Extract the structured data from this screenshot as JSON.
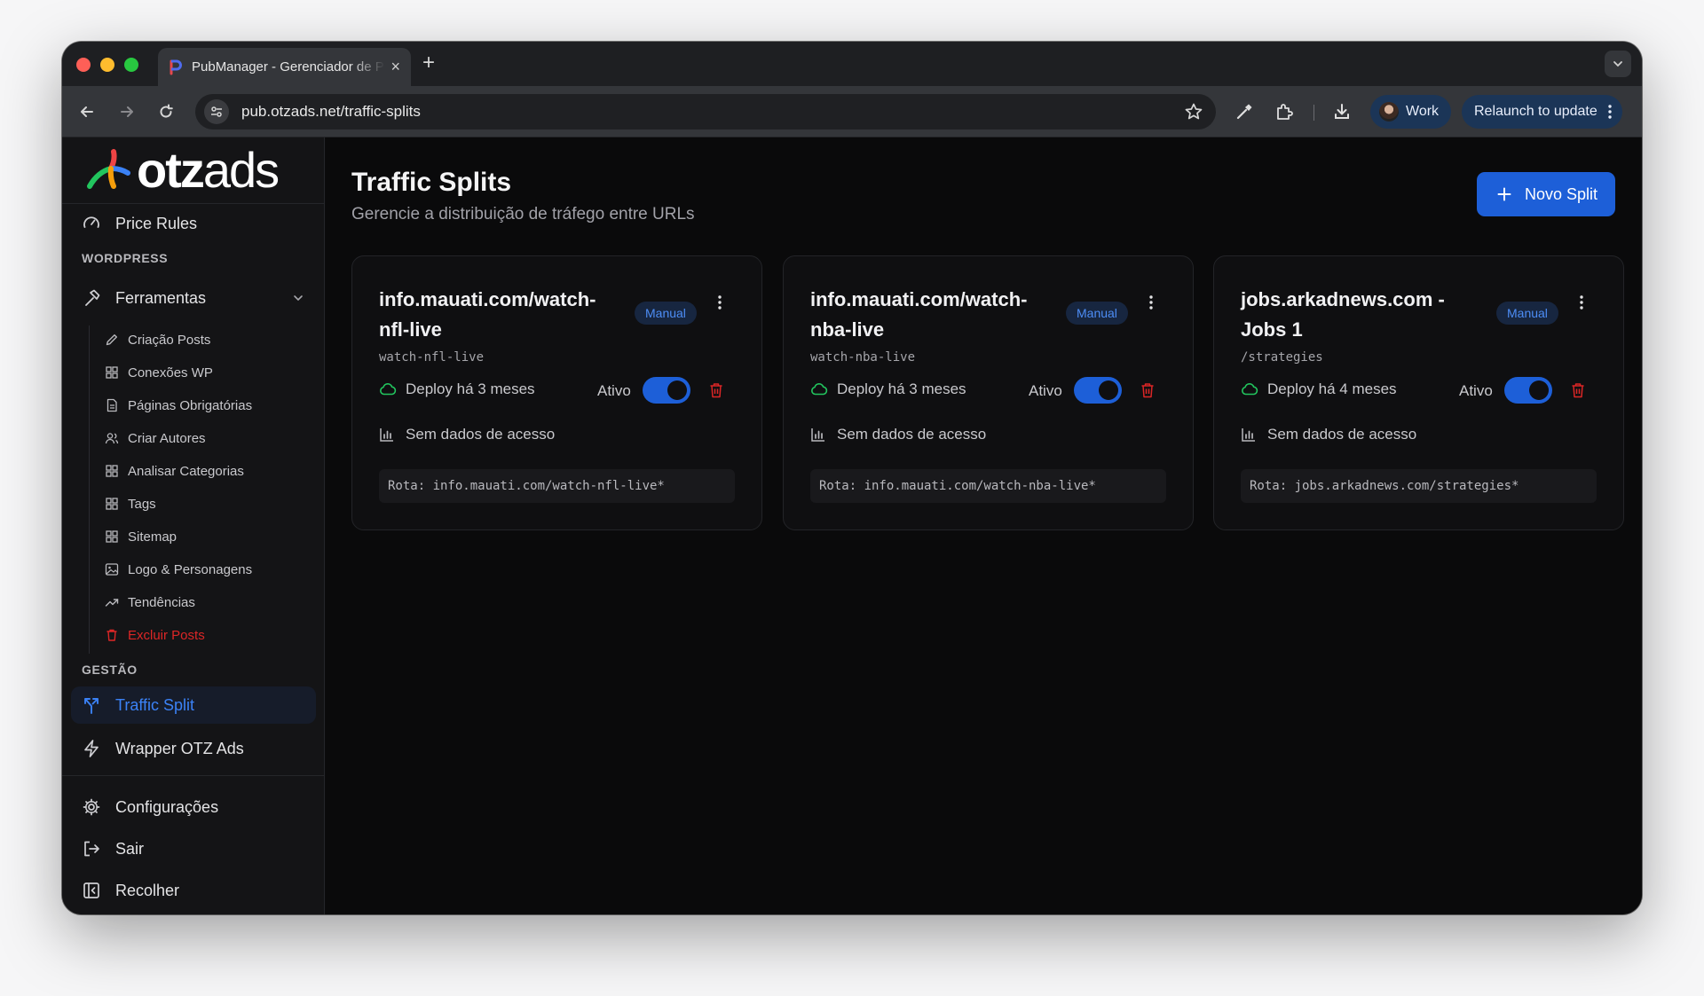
{
  "browser": {
    "tab": {
      "title": "PubManager - Gerenciador de Publicações"
    },
    "address": {
      "url": "pub.otzads.net/traffic-splits"
    },
    "profile": {
      "label": "Work"
    },
    "relaunch": {
      "label": "Relaunch to update"
    }
  },
  "app": {
    "logo": {
      "bold": "otz",
      "thin": "ads"
    },
    "sidebar": {
      "top_item": {
        "label": "Price Rules",
        "icon": "gauge-icon"
      },
      "section_wordpress": "WORDPRESS",
      "tools": {
        "label": "Ferramentas",
        "icon": "hammer-icon",
        "expanded": true
      },
      "tool_items": [
        {
          "label": "Criação Posts",
          "icon": "pencil-icon"
        },
        {
          "label": "Conexões WP",
          "icon": "grid-icon"
        },
        {
          "label": "Páginas Obrigatórias",
          "icon": "file-icon"
        },
        {
          "label": "Criar Autores",
          "icon": "users-icon"
        },
        {
          "label": "Analisar Categorias",
          "icon": "grid-icon"
        },
        {
          "label": "Tags",
          "icon": "grid-icon"
        },
        {
          "label": "Sitemap",
          "icon": "grid-icon"
        },
        {
          "label": "Logo & Personagens",
          "icon": "image-icon"
        },
        {
          "label": "Tendências",
          "icon": "trending-icon"
        },
        {
          "label": "Excluir Posts",
          "icon": "trash-icon"
        }
      ],
      "section_gestao": "GESTÃO",
      "gestao_items": [
        {
          "label": "Traffic Split",
          "icon": "split-icon",
          "active": true
        },
        {
          "label": "Wrapper OTZ Ads",
          "icon": "bolt-icon"
        }
      ],
      "bottom_items": [
        {
          "label": "Configurações",
          "icon": "gear-icon"
        },
        {
          "label": "Sair",
          "icon": "logout-icon"
        },
        {
          "label": "Recolher",
          "icon": "collapse-icon"
        }
      ]
    },
    "header": {
      "title": "Traffic Splits",
      "subtitle": "Gerencie a distribuição de tráfego entre URLs",
      "new_button": "Novo Split"
    },
    "cards": [
      {
        "title": "info.mauati.com/watch-nfl-live",
        "badge": "Manual",
        "slug": "watch-nfl-live",
        "deploy": "Deploy há 3 meses",
        "status_label": "Ativo",
        "status_on": true,
        "stats": "Sem dados de acesso",
        "route": "Rota: info.mauati.com/watch-nfl-live*"
      },
      {
        "title": "info.mauati.com/watch-nba-live",
        "badge": "Manual",
        "slug": "watch-nba-live",
        "deploy": "Deploy há 3 meses",
        "status_label": "Ativo",
        "status_on": true,
        "stats": "Sem dados de acesso",
        "route": "Rota: info.mauati.com/watch-nba-live*"
      },
      {
        "title": "jobs.arkadnews.com - Jobs 1",
        "badge": "Manual",
        "slug": "/strategies",
        "deploy": "Deploy há 4 meses",
        "status_label": "Ativo",
        "status_on": true,
        "stats": "Sem dados de acesso",
        "route": "Rota: jobs.arkadnews.com/strategies*"
      }
    ],
    "colors": {
      "accent": "#1d5fd8",
      "accent_text": "#3b82f6",
      "danger": "#dc2626",
      "deploy_ok": "#22c55e"
    }
  }
}
